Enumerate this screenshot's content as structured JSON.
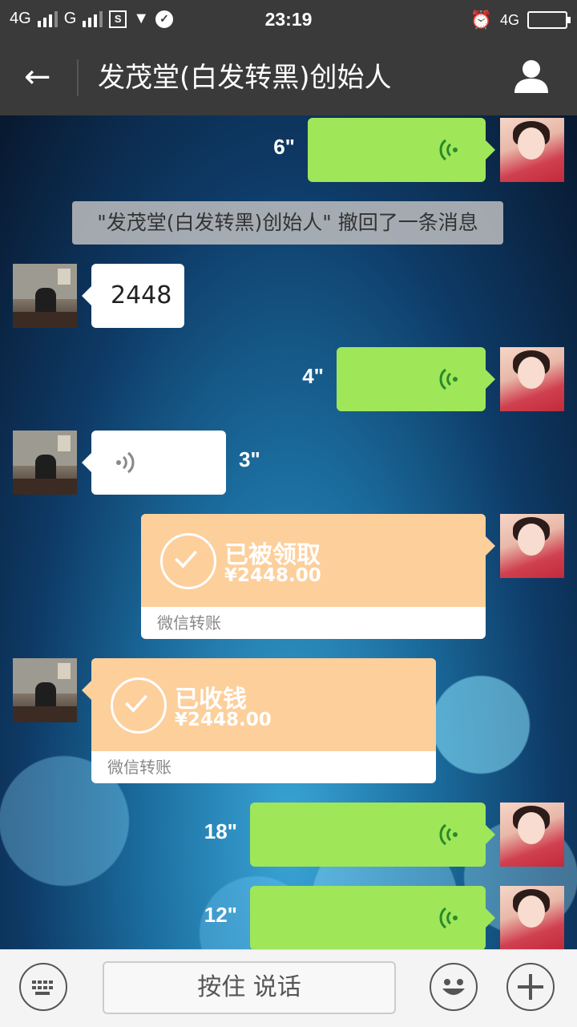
{
  "status_bar": {
    "signal1": "4G",
    "signal2": "G",
    "time": "23:19",
    "network_right": "4G"
  },
  "nav": {
    "title": "发茂堂(白发转黑)创始人"
  },
  "messages": {
    "voice1_duration": "6\"",
    "recall_notice": "\"发茂堂(白发转黑)创始人\" 撤回了一条消息",
    "text1": "2448",
    "voice2_duration": "4\"",
    "voice3_duration": "3\"",
    "transfer1": {
      "title": "已被领取",
      "amount": "¥2448.00",
      "footer": "微信转账"
    },
    "transfer2": {
      "title": "已收钱",
      "amount": "¥2448.00",
      "footer": "微信转账"
    },
    "voice4_duration": "18\"",
    "voice5_duration": "12\""
  },
  "input_bar": {
    "hold_to_talk": "按住 说话"
  },
  "colors": {
    "bar": "#3a3a3a",
    "voice_bubble": "#9fe659",
    "transfer": "#fdcf9b"
  }
}
